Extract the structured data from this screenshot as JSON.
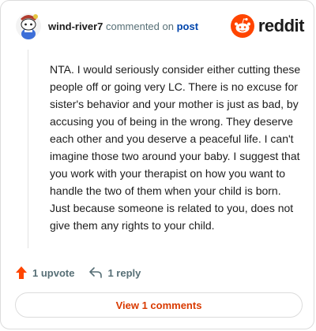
{
  "comment": {
    "username": "wind-river7",
    "action_text": " commented on ",
    "post_link": "post",
    "body": "NTA. I would seriously consider either cutting these people off or going very LC. There is no excuse for sister's behavior and your mother is just as bad, by accusing you of being in the wrong. They deserve each other and you deserve a peaceful life. I can't imagine those two around your baby. I suggest that you work with your therapist on how you want to handle the two of them when your child is born. Just because someone is related to you, does not give them any rights to your child."
  },
  "brand": {
    "wordmark": "reddit",
    "color": "#ff4500"
  },
  "actions": {
    "upvote_label": "1 upvote",
    "reply_label": "1 reply"
  },
  "footer": {
    "view_comments_label": "View 1 comments"
  },
  "colors": {
    "upvote_accent": "#ff4500",
    "view_button_text": "#d93a00",
    "link": "#0045ac"
  },
  "icons": {
    "avatar": "snoo-avatar-icon",
    "logo": "reddit-alien-icon",
    "upvote": "upvote-arrow-icon",
    "reply": "reply-arrow-icon"
  }
}
